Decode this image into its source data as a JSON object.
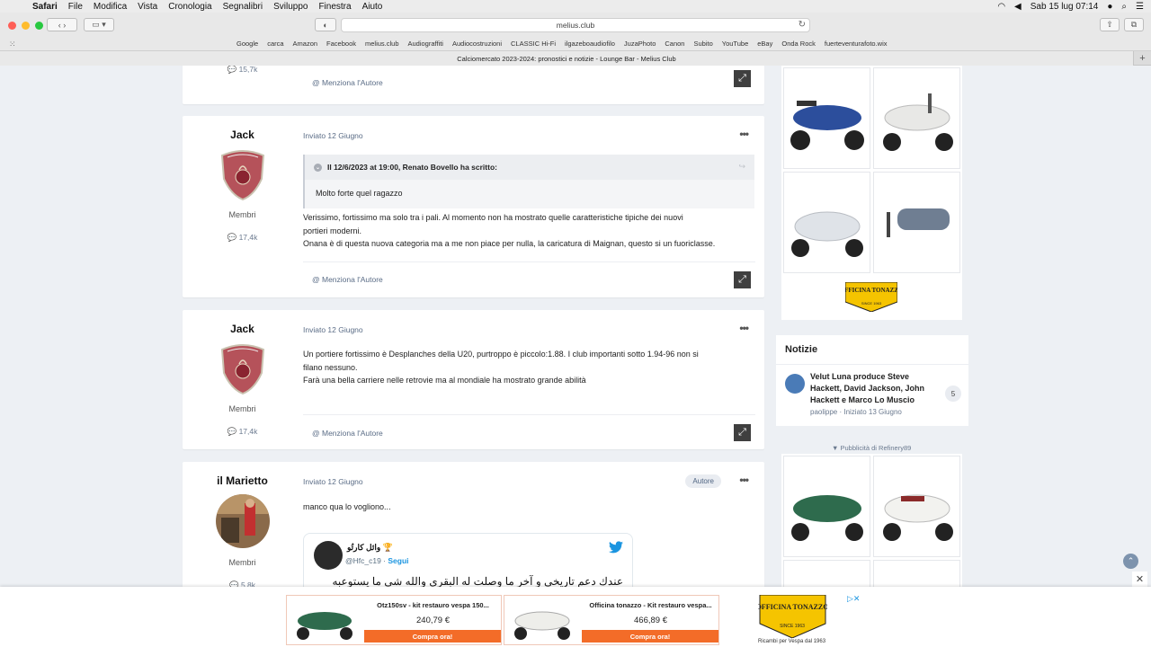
{
  "menubar": {
    "items": [
      "Safari",
      "File",
      "Modifica",
      "Vista",
      "Cronologia",
      "Segnalibri",
      "Sviluppo",
      "Finestra",
      "Aiuto"
    ],
    "clock": "Sab 15 lug  07:14"
  },
  "browser": {
    "address": "melius.club",
    "bookmarks": [
      "Google",
      "carca",
      "Amazon",
      "Facebook",
      "melius.club",
      "Audiograffiti",
      "Audiocostruzioni",
      "CLASSIC Hi-Fi",
      "ilgazeboaudiofilo",
      "JuzaPhoto",
      "Canon",
      "Subito",
      "YouTube",
      "eBay",
      "Onda Rock",
      "fuerteventurafoto.wix"
    ],
    "tab_title": "Calciomercato 2023-2024: pronostici e notizie - Lounge Bar - Melius Club"
  },
  "posts": [
    {
      "count": "15,7k",
      "mention": "@ Menziona l'Autore"
    },
    {
      "author": "Jack",
      "role": "Membri",
      "count": "17,4k",
      "date": "Inviato 12 Giugno",
      "quote_header": "Il 12/6/2023 at 19:00, Renato Bovello ha scritto:",
      "quote_body": "Molto forte quel ragazzo",
      "lines": [
        "Verissimo, fortissimo ma solo tra i pali. Al momento non ha mostrato quelle caratteristiche tipiche dei nuovi",
        "portieri moderni.",
        "Onana è di questa nuova categoria ma a me non piace per nulla, la caricatura di Maignan, questo si un fuoriclasse."
      ],
      "mention": "@ Menziona l'Autore"
    },
    {
      "author": "Jack",
      "role": "Membri",
      "count": "17,4k",
      "date": "Inviato 12 Giugno",
      "lines": [
        "Un portiere fortissimo è Desplanches della U20, purtroppo è piccolo:1.88. I club importanti sotto 1.94-96 non si",
        "filano nessuno.",
        "Farà una bella carriere nelle retrovie ma al mondiale ha mostrato grande abilità"
      ],
      "mention": "@ Menziona l'Autore"
    },
    {
      "author": "il Marietto",
      "role": "Membri",
      "count": "5,8k",
      "date": "Inviato 12 Giugno",
      "badge": "Autore",
      "lines": [
        "manco qua lo vogliono..."
      ],
      "tweet": {
        "name": "وائل كارتُو 🏆",
        "handle": "@Hfc_c19",
        "sep": " · ",
        "follow": "Segui",
        "text": "عندك دعم تاريخي و آخر ما وصلت له البقري والله شي ما يستوعبه"
      }
    }
  ],
  "sidebar": {
    "notizie_title": "Notizie",
    "topic_title": "Velut Luna produce Steve Hackett, David Jackson, John Hackett e Marco Lo Muscio",
    "topic_meta": "paolippe · Iniziato 13 Giugno",
    "topic_count": "5",
    "ad_label": "▼ Pubblicità di Refinery89",
    "logo_top": "OFFICINA TONAZZO",
    "logo_sub": "SINCE 1963"
  },
  "bottom_ads": [
    {
      "title": "Otz150sv - kit restauro vespa 150...",
      "price": "240,79 €",
      "button": "Compra ora!"
    },
    {
      "title": "Officina tonazzo - Kit restauro vespa...",
      "price": "466,89 €",
      "button": "Compra ora!"
    }
  ],
  "bottom_logo_caption": "Ricambi per Vespa dal 1963",
  "colors": {
    "accent_link": "#5a6c86",
    "tweet_blue": "#1b95e0",
    "buy_button": "#f36c28",
    "page_bg": "#edf0f4"
  }
}
